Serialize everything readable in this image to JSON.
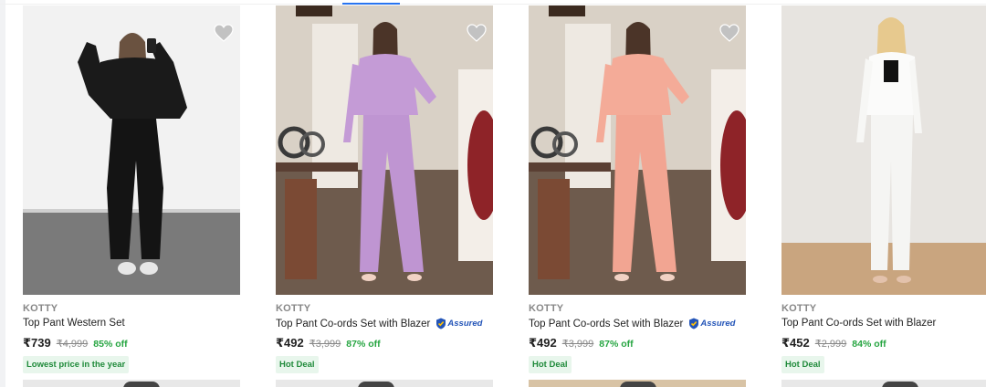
{
  "products": [
    {
      "brand": "KOTTY",
      "title": "Top Pant Western Set",
      "price": "₹739",
      "mrp": "₹4,999",
      "discount": "85% off",
      "badge": "Lowest price in the year",
      "assured": false,
      "outfit_color": "#161616",
      "wishlist_icon": "heart-icon"
    },
    {
      "brand": "KOTTY",
      "title": "Top Pant Co-ords Set with Blazer",
      "price": "₹492",
      "mrp": "₹3,999",
      "discount": "87% off",
      "badge": "Hot Deal",
      "assured": true,
      "assured_label": "Assured",
      "outfit_color": "#c49bd6",
      "wishlist_icon": "heart-icon"
    },
    {
      "brand": "KOTTY",
      "title": "Top Pant Co-ords Set with Blazer",
      "price": "₹492",
      "mrp": "₹3,999",
      "discount": "87% off",
      "badge": "Hot Deal",
      "assured": true,
      "assured_label": "Assured",
      "outfit_color": "#f4ab98",
      "wishlist_icon": "heart-icon"
    },
    {
      "brand": "KOTTY",
      "title": "Top Pant Co-ords Set with Blazer",
      "price": "₹452",
      "mrp": "₹2,999",
      "discount": "84% off",
      "badge": "Hot Deal",
      "assured": false,
      "outfit_color": "#f4f4f2",
      "wishlist_icon": "heart-icon"
    }
  ],
  "colors": {
    "discount_green": "#26a541",
    "badge_bg": "#e8f6ec",
    "assured_blue": "#2455b8",
    "heart_grey": "#c2c2c2"
  }
}
